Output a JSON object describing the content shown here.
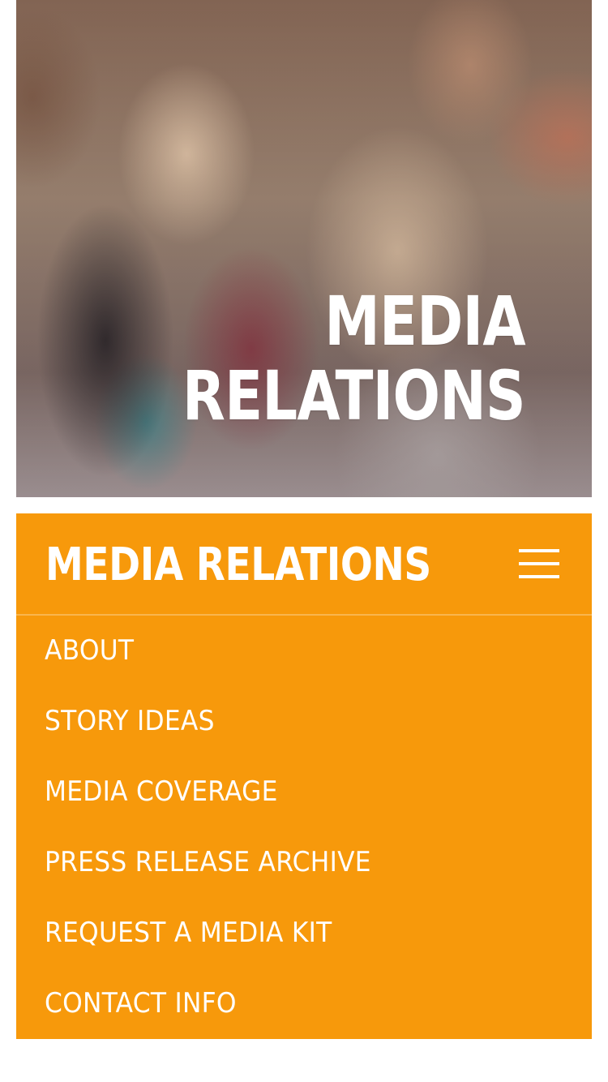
{
  "hero": {
    "title": "MEDIA\nRELATIONS",
    "image": "blurred-crowd-photo"
  },
  "nav": {
    "section_title": "MEDIA RELATIONS",
    "menu_icon": "hamburger-icon",
    "items": [
      {
        "label": "ABOUT"
      },
      {
        "label": "STORY IDEAS"
      },
      {
        "label": "MEDIA COVERAGE"
      },
      {
        "label": "PRESS RELEASE ARCHIVE"
      },
      {
        "label": "REQUEST A MEDIA KIT"
      },
      {
        "label": "CONTACT INFO"
      }
    ]
  },
  "colors": {
    "accent": "#f7990b",
    "text_on_accent": "#ffffff"
  }
}
